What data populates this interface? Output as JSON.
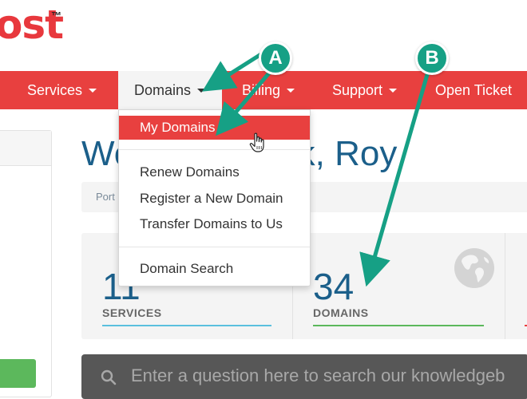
{
  "logo": {
    "text": "ost",
    "tm": "™"
  },
  "nav": {
    "items": [
      {
        "label": "Services"
      },
      {
        "label": "Domains"
      },
      {
        "label": "Billing"
      },
      {
        "label": "Support"
      },
      {
        "label": "Open Ticket"
      }
    ]
  },
  "dropdown": {
    "items": [
      {
        "label": "My Domains"
      },
      {
        "label": "Renew Domains"
      },
      {
        "label": "Register a New Domain"
      },
      {
        "label": "Transfer Domains to Us"
      },
      {
        "label": "Domain Search"
      }
    ]
  },
  "welcome": {
    "visible_start": "We",
    "visible_end": "ck, Roy"
  },
  "breadcrumb": {
    "text": "Port"
  },
  "stats": [
    {
      "number": "11",
      "label": "SERVICES",
      "bar_color": "#5bc0de",
      "icon": ""
    },
    {
      "number": "34",
      "label": "DOMAINS",
      "bar_color": "#5cb85c",
      "icon": "globe-icon"
    },
    {
      "number": "",
      "label": "",
      "bar_color": "#e8403f",
      "icon": ""
    }
  ],
  "search": {
    "placeholder": "Enter a question here to search our knowledgeb"
  },
  "annotations": {
    "a": {
      "label": "A",
      "color": "#16a085"
    },
    "b": {
      "label": "B",
      "color": "#16a085"
    }
  },
  "colors": {
    "brand_red": "#e8403f",
    "title_blue": "#1b5f8a",
    "annotation_teal": "#16a085"
  }
}
